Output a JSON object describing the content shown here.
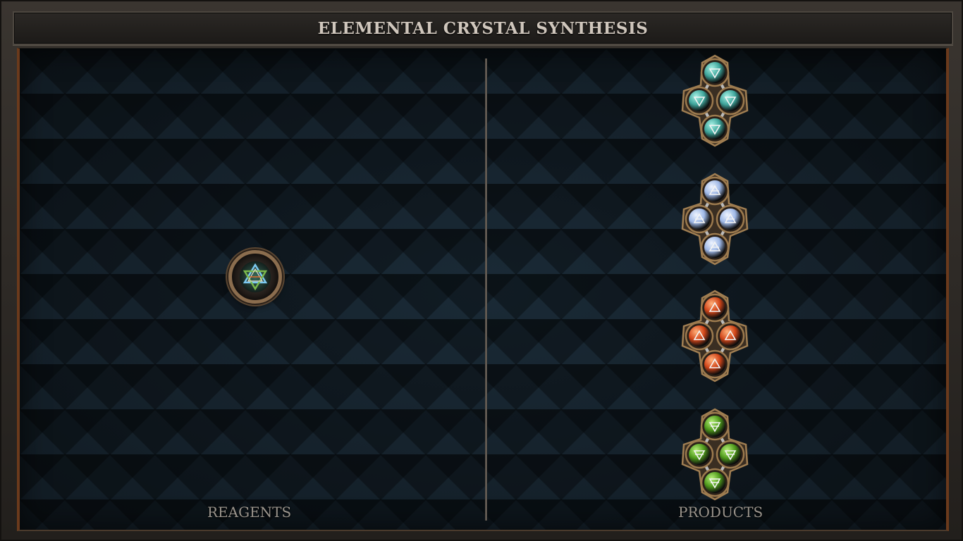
{
  "title": "ELEMENTAL CRYSTAL SYNTHESIS",
  "panels": {
    "reagents_label": "REAGENTS",
    "products_label": "PRODUCTS"
  },
  "reagent": {
    "icon": "hexagram-icon",
    "colors": [
      "#7cc8f0",
      "#e06a2c",
      "#7ab84c",
      "#e8e2d6"
    ]
  },
  "products": [
    {
      "element": "water",
      "icon": "water-triangle-icon",
      "orb_color": "#3fa59b",
      "orb_light": "#a6f0e4",
      "count": 4
    },
    {
      "element": "air",
      "icon": "air-triangle-icon",
      "orb_color": "#9fb8e6",
      "orb_light": "#eef4ff",
      "count": 4
    },
    {
      "element": "fire",
      "icon": "fire-triangle-icon",
      "orb_color": "#d2461a",
      "orb_light": "#ffb07a",
      "count": 4
    },
    {
      "element": "earth",
      "icon": "earth-triangle-icon",
      "orb_color": "#4f9a1c",
      "orb_light": "#b8f07a",
      "count": 4
    }
  ]
}
